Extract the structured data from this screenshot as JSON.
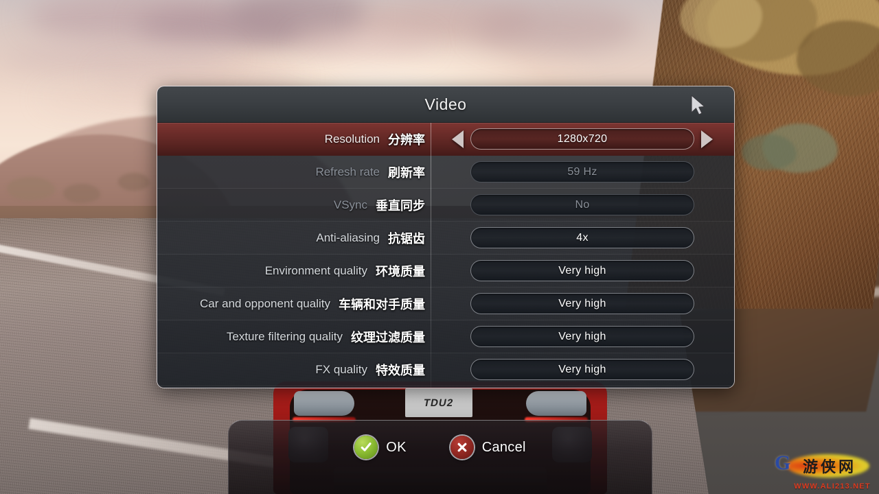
{
  "background": {
    "scene_description": "racing game sunset desert road",
    "car_plate": "TDU2"
  },
  "watermark": {
    "glyph": "G",
    "cn_text": "游侠网",
    "url": "WWW.ALI213.NET"
  },
  "dialog": {
    "title": "Video",
    "cursor_icon": "mouse-pointer-icon",
    "rows": [
      {
        "label_en": "Resolution",
        "label_cn": "分辨率",
        "value": "1280x720",
        "selected": true,
        "disabled": false,
        "has_arrows": true,
        "left_arrow_icon": "triangle-left-icon",
        "right_arrow_icon": "triangle-right-icon"
      },
      {
        "label_en": "Refresh rate",
        "label_cn": "刷新率",
        "value": "59 Hz",
        "selected": false,
        "disabled": true,
        "has_arrows": false
      },
      {
        "label_en": "VSync",
        "label_cn": "垂直同步",
        "value": "No",
        "selected": false,
        "disabled": true,
        "has_arrows": false
      },
      {
        "label_en": "Anti-aliasing",
        "label_cn": "抗锯齿",
        "value": "4x",
        "selected": false,
        "disabled": false,
        "has_arrows": false
      },
      {
        "label_en": "Environment quality",
        "label_cn": "环境质量",
        "value": "Very high",
        "selected": false,
        "disabled": false,
        "has_arrows": false
      },
      {
        "label_en": "Car and opponent quality",
        "label_cn": "车辆和对手质量",
        "value": "Very high",
        "selected": false,
        "disabled": false,
        "has_arrows": false
      },
      {
        "label_en": "Texture filtering quality",
        "label_cn": "纹理过滤质量",
        "value": "Very high",
        "selected": false,
        "disabled": false,
        "has_arrows": false
      },
      {
        "label_en": "FX quality",
        "label_cn": "特效质量",
        "value": "Very high",
        "selected": false,
        "disabled": false,
        "has_arrows": false
      }
    ]
  },
  "actions": {
    "ok": {
      "label": "OK",
      "icon": "check-circle-icon",
      "color": "#8dbd34"
    },
    "cancel": {
      "label": "Cancel",
      "icon": "x-circle-icon",
      "color": "#962a24"
    }
  },
  "colors": {
    "selected_row": "#6d2d2a",
    "dialog_border": "#dedee4",
    "titlebar": "#3a3e42",
    "disabled_text": "#8a9099"
  }
}
